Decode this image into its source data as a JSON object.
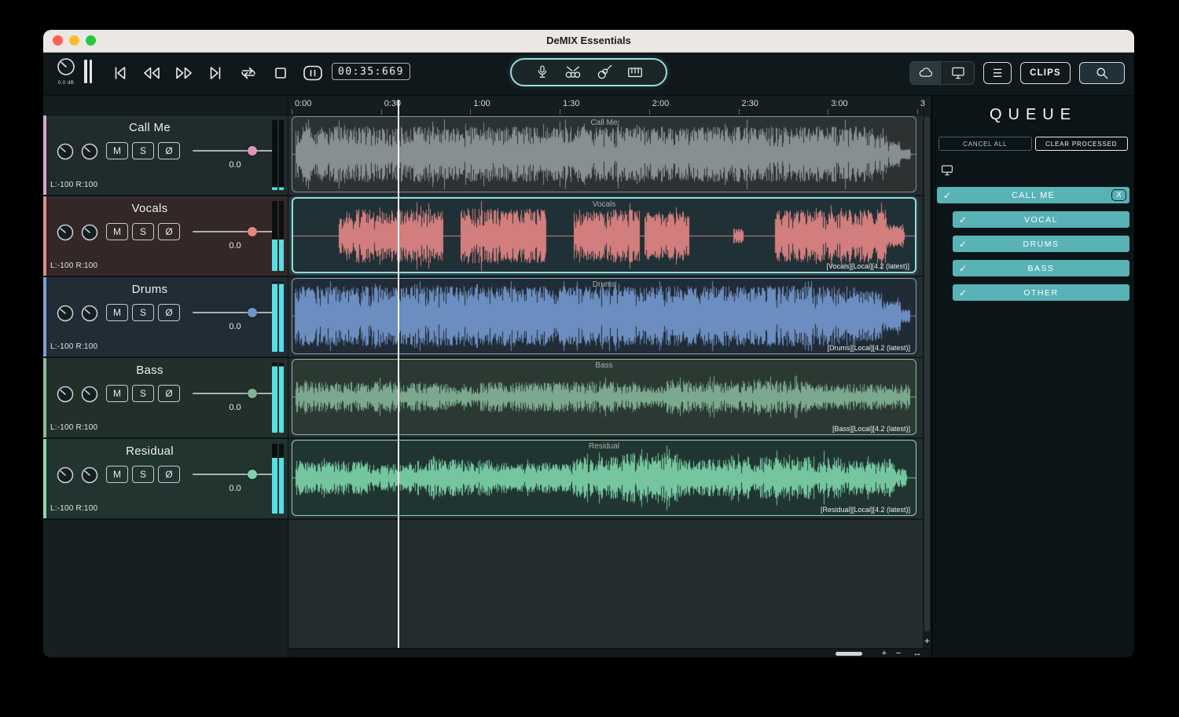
{
  "window": {
    "title": "DeMIX Essentials"
  },
  "toolbar": {
    "db": "0.0 dB",
    "time": "00:35:669",
    "clips": "CLIPS",
    "transport_icons": [
      "skip-start",
      "rewind",
      "fast-forward",
      "skip-end",
      "loop",
      "stop",
      "pause"
    ],
    "instrument_icons": [
      "microphone",
      "drums",
      "guitar",
      "piano"
    ],
    "right_icons": [
      "cloud",
      "monitor",
      "menu",
      "search"
    ]
  },
  "labels": {
    "mute": "M",
    "solo": "S",
    "phase": "Ø"
  },
  "ruler": {
    "ticks": [
      "0:00",
      "0:30",
      "1:00",
      "1:30",
      "2:00",
      "2:30",
      "3:00",
      "3"
    ]
  },
  "zoom": {
    "h_plus": "+",
    "h_minus": "−",
    "h_fit": "↔",
    "v_plus": "+"
  },
  "playhead": {
    "time_seconds": 35.669
  },
  "tracks": [
    {
      "name": "Call Me",
      "value": "0.0",
      "pan": "L:-100 R:100",
      "clip_label": "",
      "meter": 0.04,
      "texture": 0.55,
      "selected": false,
      "style": {
        "color": "#8f9798",
        "strip": "#d9a8c4",
        "handle": "#e393bb",
        "hbg": "#202b2e",
        "cbg": "#2c3132",
        "cbd": "#868e8f"
      },
      "envelope": [
        [
          0.004,
          0.93,
          0.82
        ],
        [
          0.93,
          0.955,
          0.6
        ],
        [
          0.955,
          0.975,
          0.38
        ],
        [
          0.975,
          0.992,
          0.16
        ]
      ]
    },
    {
      "name": "Vocals",
      "value": "0.0",
      "pan": "L:-100 R:100",
      "clip_label": "[Vocals][Local][4.2 (latest)]",
      "meter": 0.45,
      "texture": 0.5,
      "selected": true,
      "style": {
        "color": "#e28584",
        "strip": "#e08b8a",
        "handle": "#e28584",
        "hbg": "#342728",
        "cbg": "#1f3036",
        "cbd": "#8fd9de"
      },
      "envelope": [
        [
          0.073,
          0.1,
          0.55
        ],
        [
          0.1,
          0.24,
          0.8
        ],
        [
          0.268,
          0.405,
          0.8
        ],
        [
          0.45,
          0.555,
          0.78
        ],
        [
          0.563,
          0.635,
          0.72
        ],
        [
          0.705,
          0.722,
          0.22
        ],
        [
          0.772,
          0.952,
          0.78
        ],
        [
          0.952,
          0.98,
          0.35
        ]
      ]
    },
    {
      "name": "Drums",
      "value": "0.0",
      "pan": "L:-100 R:100",
      "clip_label": "[Drums][Local][4.2 (latest)]",
      "meter": 0.97,
      "texture": 0.38,
      "selected": false,
      "style": {
        "color": "#7396cb",
        "strip": "#7d9fd4",
        "handle": "#6f94cb",
        "hbg": "#222c36",
        "cbg": "#202b36",
        "cbd": "#84a0b5"
      },
      "envelope": [
        [
          0.003,
          0.9,
          0.88
        ],
        [
          0.9,
          0.945,
          0.75
        ],
        [
          0.945,
          0.975,
          0.45
        ],
        [
          0.975,
          0.99,
          0.2
        ]
      ]
    },
    {
      "name": "Bass",
      "value": "0.0",
      "pan": "L:-100 R:100",
      "clip_label": "[Bass][Local][4.2 (latest)]",
      "meter": 0.95,
      "texture": 0.85,
      "selected": false,
      "style": {
        "color": "#83b297",
        "strip": "#8bbb9e",
        "handle": "#83b297",
        "hbg": "#22302a",
        "cbg": "#2a3a33",
        "cbd": "#8fb9a2"
      },
      "envelope": [
        [
          0.004,
          0.25,
          0.45
        ],
        [
          0.25,
          0.3,
          0.3
        ],
        [
          0.3,
          0.55,
          0.45
        ],
        [
          0.55,
          0.6,
          0.35
        ],
        [
          0.6,
          0.85,
          0.48
        ],
        [
          0.85,
          0.99,
          0.4
        ]
      ]
    },
    {
      "name": "Residual",
      "value": "0.0",
      "pan": "L:-100 R:100",
      "clip_label": "[Residual][Local][4.2 (latest)]",
      "meter": 0.8,
      "texture": 0.65,
      "selected": false,
      "style": {
        "color": "#7dd3a8",
        "strip": "#86d8ae",
        "handle": "#7dd3a8",
        "hbg": "#213430",
        "cbg": "#203531",
        "cbd": "#8cd6b1"
      },
      "envelope": [
        [
          0.005,
          0.12,
          0.5
        ],
        [
          0.12,
          0.2,
          0.4
        ],
        [
          0.2,
          0.32,
          0.55
        ],
        [
          0.32,
          0.45,
          0.45
        ],
        [
          0.45,
          0.52,
          0.62
        ],
        [
          0.52,
          0.62,
          0.75
        ],
        [
          0.62,
          0.75,
          0.55
        ],
        [
          0.75,
          0.88,
          0.62
        ],
        [
          0.88,
          0.965,
          0.5
        ],
        [
          0.965,
          0.985,
          0.3
        ]
      ]
    }
  ],
  "queue": {
    "title": "QUEUE",
    "cancel_all": "CANCEL ALL",
    "clear_processed": "CLEAR PROCESSED",
    "check": "✓",
    "job": {
      "name": "CALL ME",
      "close": "X",
      "stems": [
        "VOCAL",
        "DRUMS",
        "BASS",
        "OTHER"
      ]
    }
  }
}
